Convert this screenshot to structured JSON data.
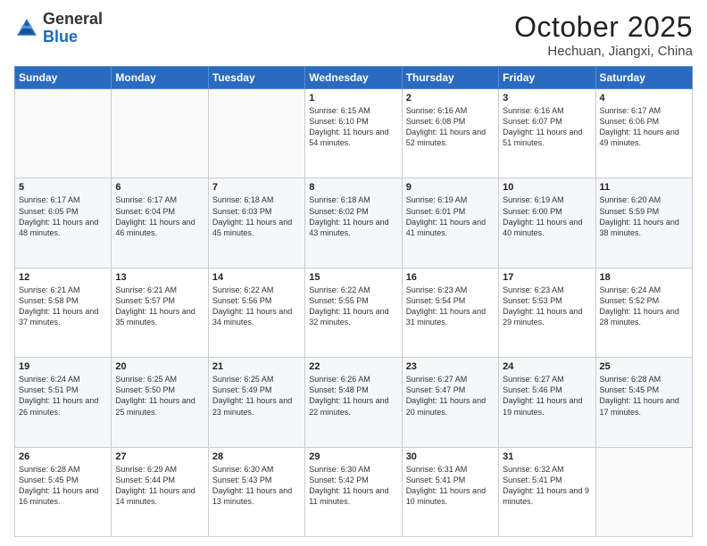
{
  "header": {
    "logo_general": "General",
    "logo_blue": "Blue",
    "month": "October 2025",
    "location": "Hechuan, Jiangxi, China"
  },
  "weekdays": [
    "Sunday",
    "Monday",
    "Tuesday",
    "Wednesday",
    "Thursday",
    "Friday",
    "Saturday"
  ],
  "weeks": [
    [
      {
        "day": "",
        "text": ""
      },
      {
        "day": "",
        "text": ""
      },
      {
        "day": "",
        "text": ""
      },
      {
        "day": "1",
        "text": "Sunrise: 6:15 AM\nSunset: 6:10 PM\nDaylight: 11 hours and 54 minutes."
      },
      {
        "day": "2",
        "text": "Sunrise: 6:16 AM\nSunset: 6:08 PM\nDaylight: 11 hours and 52 minutes."
      },
      {
        "day": "3",
        "text": "Sunrise: 6:16 AM\nSunset: 6:07 PM\nDaylight: 11 hours and 51 minutes."
      },
      {
        "day": "4",
        "text": "Sunrise: 6:17 AM\nSunset: 6:06 PM\nDaylight: 11 hours and 49 minutes."
      }
    ],
    [
      {
        "day": "5",
        "text": "Sunrise: 6:17 AM\nSunset: 6:05 PM\nDaylight: 11 hours and 48 minutes."
      },
      {
        "day": "6",
        "text": "Sunrise: 6:17 AM\nSunset: 6:04 PM\nDaylight: 11 hours and 46 minutes."
      },
      {
        "day": "7",
        "text": "Sunrise: 6:18 AM\nSunset: 6:03 PM\nDaylight: 11 hours and 45 minutes."
      },
      {
        "day": "8",
        "text": "Sunrise: 6:18 AM\nSunset: 6:02 PM\nDaylight: 11 hours and 43 minutes."
      },
      {
        "day": "9",
        "text": "Sunrise: 6:19 AM\nSunset: 6:01 PM\nDaylight: 11 hours and 41 minutes."
      },
      {
        "day": "10",
        "text": "Sunrise: 6:19 AM\nSunset: 6:00 PM\nDaylight: 11 hours and 40 minutes."
      },
      {
        "day": "11",
        "text": "Sunrise: 6:20 AM\nSunset: 5:59 PM\nDaylight: 11 hours and 38 minutes."
      }
    ],
    [
      {
        "day": "12",
        "text": "Sunrise: 6:21 AM\nSunset: 5:58 PM\nDaylight: 11 hours and 37 minutes."
      },
      {
        "day": "13",
        "text": "Sunrise: 6:21 AM\nSunset: 5:57 PM\nDaylight: 11 hours and 35 minutes."
      },
      {
        "day": "14",
        "text": "Sunrise: 6:22 AM\nSunset: 5:56 PM\nDaylight: 11 hours and 34 minutes."
      },
      {
        "day": "15",
        "text": "Sunrise: 6:22 AM\nSunset: 5:55 PM\nDaylight: 11 hours and 32 minutes."
      },
      {
        "day": "16",
        "text": "Sunrise: 6:23 AM\nSunset: 5:54 PM\nDaylight: 11 hours and 31 minutes."
      },
      {
        "day": "17",
        "text": "Sunrise: 6:23 AM\nSunset: 5:53 PM\nDaylight: 11 hours and 29 minutes."
      },
      {
        "day": "18",
        "text": "Sunrise: 6:24 AM\nSunset: 5:52 PM\nDaylight: 11 hours and 28 minutes."
      }
    ],
    [
      {
        "day": "19",
        "text": "Sunrise: 6:24 AM\nSunset: 5:51 PM\nDaylight: 11 hours and 26 minutes."
      },
      {
        "day": "20",
        "text": "Sunrise: 6:25 AM\nSunset: 5:50 PM\nDaylight: 11 hours and 25 minutes."
      },
      {
        "day": "21",
        "text": "Sunrise: 6:25 AM\nSunset: 5:49 PM\nDaylight: 11 hours and 23 minutes."
      },
      {
        "day": "22",
        "text": "Sunrise: 6:26 AM\nSunset: 5:48 PM\nDaylight: 11 hours and 22 minutes."
      },
      {
        "day": "23",
        "text": "Sunrise: 6:27 AM\nSunset: 5:47 PM\nDaylight: 11 hours and 20 minutes."
      },
      {
        "day": "24",
        "text": "Sunrise: 6:27 AM\nSunset: 5:46 PM\nDaylight: 11 hours and 19 minutes."
      },
      {
        "day": "25",
        "text": "Sunrise: 6:28 AM\nSunset: 5:45 PM\nDaylight: 11 hours and 17 minutes."
      }
    ],
    [
      {
        "day": "26",
        "text": "Sunrise: 6:28 AM\nSunset: 5:45 PM\nDaylight: 11 hours and 16 minutes."
      },
      {
        "day": "27",
        "text": "Sunrise: 6:29 AM\nSunset: 5:44 PM\nDaylight: 11 hours and 14 minutes."
      },
      {
        "day": "28",
        "text": "Sunrise: 6:30 AM\nSunset: 5:43 PM\nDaylight: 11 hours and 13 minutes."
      },
      {
        "day": "29",
        "text": "Sunrise: 6:30 AM\nSunset: 5:42 PM\nDaylight: 11 hours and 11 minutes."
      },
      {
        "day": "30",
        "text": "Sunrise: 6:31 AM\nSunset: 5:41 PM\nDaylight: 11 hours and 10 minutes."
      },
      {
        "day": "31",
        "text": "Sunrise: 6:32 AM\nSunset: 5:41 PM\nDaylight: 11 hours and 9 minutes."
      },
      {
        "day": "",
        "text": ""
      }
    ]
  ]
}
